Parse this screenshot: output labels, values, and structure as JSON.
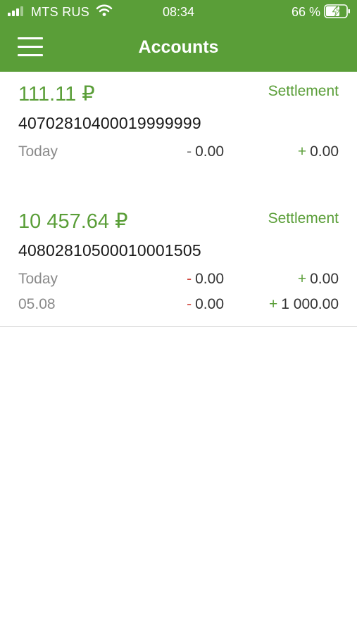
{
  "status": {
    "carrier": "MTS RUS",
    "time": "08:34",
    "battery_pct": "66 %"
  },
  "header": {
    "title": "Accounts"
  },
  "accounts": [
    {
      "amount": "111.11 ₽",
      "type": "Settlement",
      "number": "40702810400019999999",
      "rows": [
        {
          "date": "Today",
          "debit_sign": "-",
          "debit": "0.00",
          "credit_sign": "+",
          "credit": "0.00"
        }
      ]
    },
    {
      "amount": "10 457.64 ₽",
      "type": "Settlement",
      "number": "40802810500010001505",
      "rows": [
        {
          "date": "Today",
          "debit_sign": "-",
          "debit": "0.00",
          "credit_sign": "+",
          "credit": "0.00"
        },
        {
          "date": "05.08",
          "debit_sign": "-",
          "debit": "0.00",
          "credit_sign": "+",
          "credit": "1 000.00"
        }
      ]
    }
  ],
  "colors": {
    "brand": "#5a9e38",
    "debit_red": "#d0453b"
  },
  "icons": [
    "signal-icon",
    "wifi-icon",
    "battery-charging-icon",
    "menu-icon"
  ]
}
